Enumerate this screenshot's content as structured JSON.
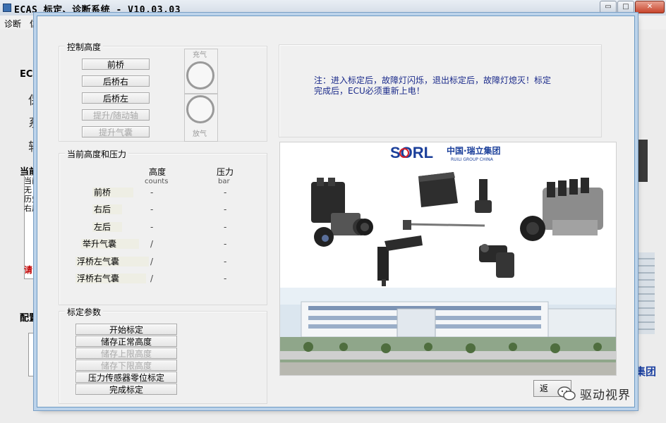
{
  "window": {
    "title": "ECAS 标定、诊断系统 - V10.03.03",
    "minimize": "▭",
    "restore": "□",
    "close": "✕"
  },
  "menu": [
    "诊断",
    "信"
  ],
  "parent": {
    "ecu_label": "ECU",
    "side_chars": [
      "保",
      "系",
      "轴"
    ],
    "current_label": "当前",
    "lines": [
      "当前",
      "无",
      "历史",
      "右后"
    ],
    "red_text": "请",
    "config_label": "配置",
    "blue_text": "集团"
  },
  "dialog": {
    "control_height": {
      "title": "控制高度",
      "buttons": [
        {
          "label": "前桥",
          "enabled": true
        },
        {
          "label": "后桥右",
          "enabled": true
        },
        {
          "label": "后桥左",
          "enabled": true
        },
        {
          "label": "提升/随动轴",
          "enabled": false
        },
        {
          "label": "提升气囊",
          "enabled": false
        }
      ],
      "inflate_label": "充气",
      "deflate_label": "放气"
    },
    "note": {
      "line1": "注：进入标定后，故障灯闪烁，退出标定后，故障灯熄灭！标定",
      "line2": "完成后，ECU必须重新上电！"
    },
    "current_state": {
      "title": "当前高度和压力",
      "col_height": "高度",
      "col_height_unit": "counts",
      "col_pressure": "压力",
      "col_pressure_unit": "bar",
      "rows": [
        {
          "label": "前桥",
          "height": "-",
          "pressure": "-"
        },
        {
          "label": "右后",
          "height": "-",
          "pressure": "-"
        },
        {
          "label": "左后",
          "height": "-",
          "pressure": "-"
        },
        {
          "label": "举升气囊",
          "height": "/",
          "pressure": "-"
        },
        {
          "label": "浮桥左气囊",
          "height": "/",
          "pressure": "-"
        },
        {
          "label": "浮桥右气囊",
          "height": "/",
          "pressure": "-"
        }
      ]
    },
    "calibration": {
      "title": "标定参数",
      "buttons": [
        {
          "label": "开始标定",
          "enabled": true
        },
        {
          "label": "储存正常高度",
          "enabled": true
        },
        {
          "label": "储存上限高度",
          "enabled": false
        },
        {
          "label": "储存下限高度",
          "enabled": false
        },
        {
          "label": "压力传感器零位标定",
          "enabled": true
        },
        {
          "label": "完成标定",
          "enabled": true
        }
      ]
    },
    "photo": {
      "brand": "SORL",
      "brand_cn": "中国·瑞立集团",
      "brand_en": "RUILI GROUP CHINA"
    },
    "return_button": "返"
  },
  "watermark": "驱动视界",
  "colors": {
    "note_text": "#1a2a8a",
    "disabled_text": "#a8a8a8",
    "sorl_blue": "#1b3f9a",
    "sorl_red": "#d4202a"
  }
}
